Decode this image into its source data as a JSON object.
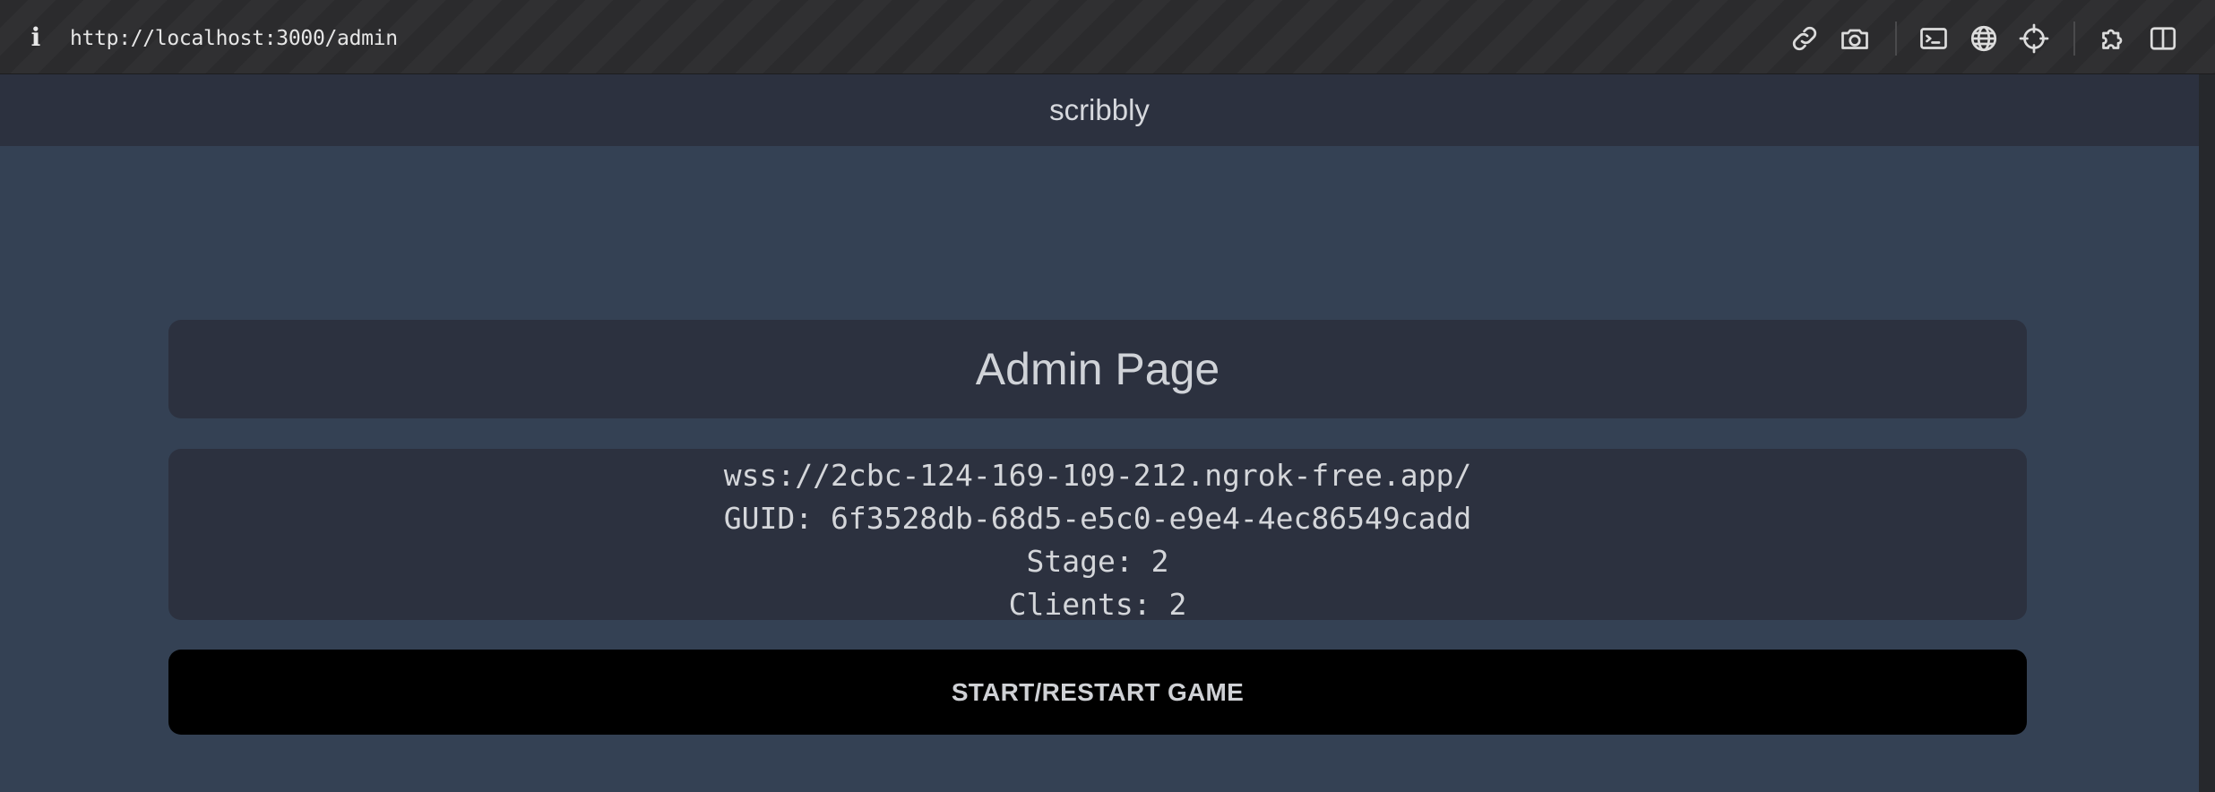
{
  "browser": {
    "url": "http://localhost:3000/admin",
    "info_icon_glyph": "i",
    "toolbar_icons": [
      "link-icon",
      "camera-icon",
      "terminal-icon",
      "globe-icon",
      "crosshair-icon",
      "puzzle-icon",
      "sidebar-icon"
    ]
  },
  "app": {
    "name": "scribbly"
  },
  "admin": {
    "title": "Admin Page",
    "server_url": "wss://2cbc-124-169-109-212.ngrok-free.app/",
    "guid_line": "GUID: 6f3528db-68d5-e5c0-e9e4-4ec86549cadd",
    "stage_line": "Stage: 2",
    "clients_line": "Clients: 2",
    "start_button_label": "START/RESTART GAME"
  },
  "colors": {
    "page_bg": "#344154",
    "card_bg": "#2c313f",
    "button_bg": "#000000",
    "text": "#d4d6da"
  }
}
